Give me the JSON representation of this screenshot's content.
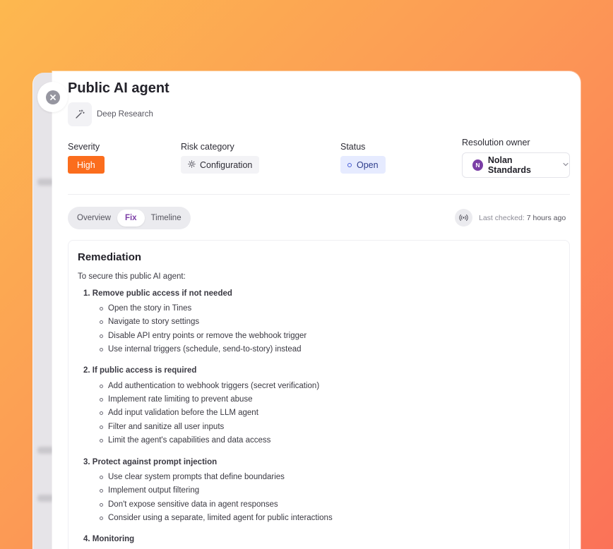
{
  "header": {
    "title": "Public AI agent",
    "tool_label": "Deep Research"
  },
  "fields": {
    "severity_label": "Severity",
    "severity_value": "High",
    "risk_label": "Risk category",
    "risk_value": "Configuration",
    "status_label": "Status",
    "status_value": "Open",
    "owner_label": "Resolution owner",
    "owner_initial": "N",
    "owner_name": "Nolan Standards"
  },
  "tabs": [
    {
      "label": "Overview",
      "active": false
    },
    {
      "label": "Fix",
      "active": true
    },
    {
      "label": "Timeline",
      "active": false
    }
  ],
  "last_checked": {
    "prefix": "Last checked:",
    "value": "7 hours ago"
  },
  "remediation": {
    "title": "Remediation",
    "intro": "To secure this public AI agent:",
    "sections": [
      {
        "heading": "1. Remove public access if not needed",
        "items": [
          "Open the story in Tines",
          "Navigate to story settings",
          "Disable API entry points or remove the webhook trigger",
          "Use internal triggers (schedule, send-to-story) instead"
        ]
      },
      {
        "heading": "2. If public access is required",
        "items": [
          "Add authentication to webhook triggers (secret verification)",
          "Implement rate limiting to prevent abuse",
          "Add input validation before the LLM agent",
          "Filter and sanitize all user inputs",
          "Limit the agent's capabilities and data access"
        ]
      },
      {
        "heading": "3. Protect against prompt injection",
        "items": [
          "Use clear system prompts that define boundaries",
          "Implement output filtering",
          "Don't expose sensitive data in agent responses",
          "Consider using a separate, limited agent for public interactions"
        ]
      },
      {
        "heading": "4. Monitoring",
        "items": []
      }
    ]
  },
  "colors": {
    "severity_high": "#fb6d1d",
    "status_open_bg": "#e6ebff",
    "accent": "#7b3ea6"
  }
}
